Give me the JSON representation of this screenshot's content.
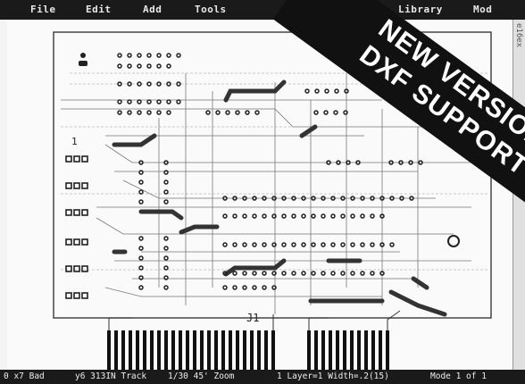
{
  "menu": {
    "items": [
      "File",
      "Edit",
      "Add",
      "Tools",
      "Library",
      "Mod"
    ]
  },
  "board": {
    "label_j1": "J1",
    "label_one": "1"
  },
  "status": {
    "fields": [
      "0 x7 Bad",
      "y6 313IN Track",
      "1/30 45' Zoom",
      "1 Layer=1 Width=.2(15)",
      "Mode 1 of 1"
    ]
  },
  "side_label": "e16ex",
  "banner": {
    "line1": "NEW VERSION",
    "line2": "DXF SUPPORT"
  },
  "colors": {
    "trace": "#333333",
    "pad": "#222222",
    "background": "#fafafa",
    "bars": "#1a1a1a",
    "banner": "#111111"
  }
}
